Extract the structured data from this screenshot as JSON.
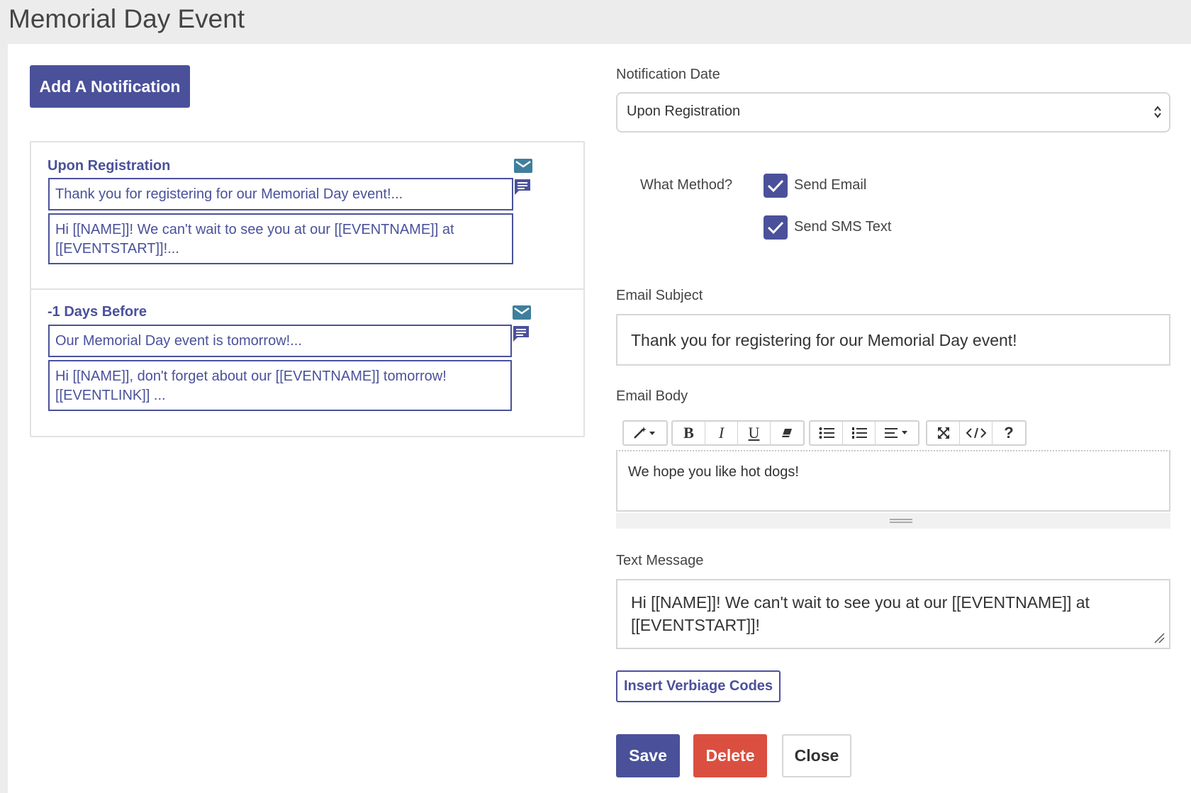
{
  "page": {
    "title": "Memorial Day Event"
  },
  "add_notification": {
    "label": "Add A Notification"
  },
  "notifications": [
    {
      "title": "Upon Registration",
      "subject_preview": "Thank you for registering for our Memorial Day event!...",
      "body_preview": "Hi [[NAME]]! We can't wait to see you at our [[EVENTNAME]] at [[EVENTSTART]]!..."
    },
    {
      "title": "-1 Days Before",
      "subject_preview": "Our Memorial Day event is tomorrow!...",
      "body_preview": "Hi [[NAME]], don't forget about our [[EVENTNAME]] tomorrow! [[EVENTLINK]] ..."
    }
  ],
  "form": {
    "notification_date_label": "Notification Date",
    "notification_date_value": "Upon Registration",
    "method_label": "What Method?",
    "send_email_label": "Send Email",
    "send_email_checked": true,
    "send_sms_label": "Send SMS Text",
    "send_sms_checked": true,
    "email_subject_label": "Email Subject",
    "email_subject_value": "Thank you for registering for our Memorial Day event!",
    "email_body_label": "Email Body",
    "email_body_value": "We hope you like hot dogs!",
    "text_message_label": "Text Message",
    "text_message_value": "Hi [[NAME]]! We can't wait to see you at our [[EVENTNAME]] at [[EVENTSTART]]!",
    "insert_codes_label": "Insert Verbiage Codes"
  },
  "toolbar": {
    "bold": "B",
    "italic": "I",
    "underline": "U",
    "help": "?"
  },
  "actions": {
    "save": "Save",
    "delete": "Delete",
    "close": "Close"
  },
  "colors": {
    "primary": "#4a519a",
    "danger": "#db4f40",
    "icon_teal": "#3f7f9e"
  }
}
